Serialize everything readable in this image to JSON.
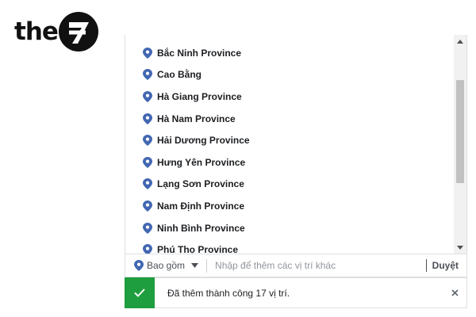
{
  "logo": {
    "text": "the",
    "brand_color": "#111111"
  },
  "locations": {
    "icon": "location-pin-icon",
    "items": [
      {
        "label": "Bắc Ninh Province"
      },
      {
        "label": "Cao Bằng"
      },
      {
        "label": "Hà Giang Province"
      },
      {
        "label": "Hà Nam Province"
      },
      {
        "label": "Hải Dương Province"
      },
      {
        "label": "Hưng Yên Province"
      },
      {
        "label": "Lạng Sơn Province"
      },
      {
        "label": "Nam Định Province"
      },
      {
        "label": "Ninh Bình Province"
      },
      {
        "label": "Phú Thọ Province"
      }
    ]
  },
  "input_bar": {
    "include_label": "Bao gồm",
    "placeholder": "Nhập để thêm các vị trí khác",
    "value": "",
    "browse_label": "Duyệt"
  },
  "toast": {
    "message": "Đã thêm thành công 17 vị trí.",
    "status_color": "#1e9e3e",
    "icon": "check-icon",
    "close_icon": "close-icon"
  },
  "colors": {
    "pin": "#4267b2",
    "text": "#1c1e21",
    "muted": "#90949c"
  }
}
